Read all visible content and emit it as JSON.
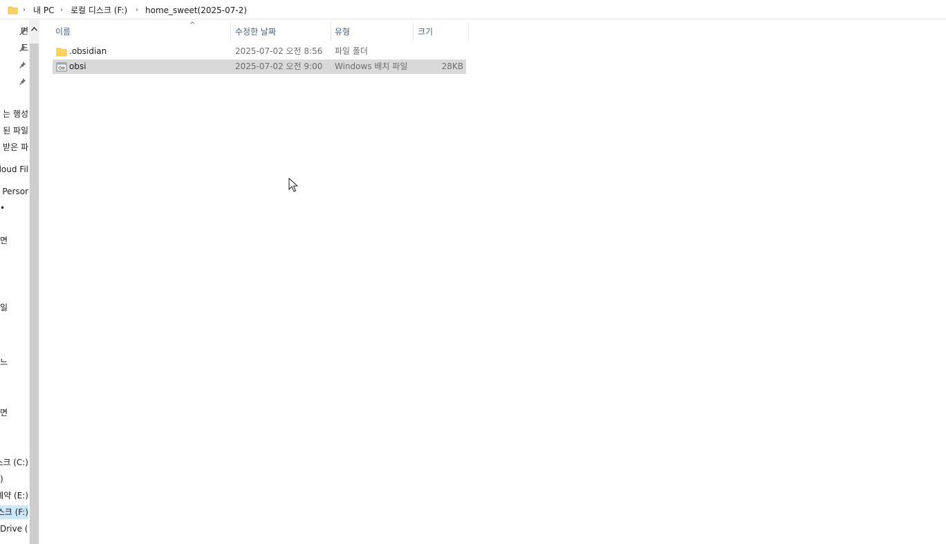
{
  "breadcrumb": {
    "items": [
      "내 PC",
      "로컬 디스크 (F:)",
      "home_sweet(2025-07-2)"
    ],
    "separator": "›"
  },
  "nav": {
    "items": [
      {
        "label": "면",
        "pinned": true
      },
      {
        "label": "드",
        "pinned": true
      },
      {
        "label": "",
        "pinned": true
      },
      {
        "label": "",
        "pinned": true
      },
      {
        "label": "는 행성"
      },
      {
        "label": "된 파일"
      },
      {
        "label": "둥 받은 파"
      },
      {
        "label": "Cloud Fil"
      },
      {
        "label": "- Persor"
      },
      {
        "label": "•"
      },
      {
        "label": "면"
      },
      {
        "label": "일"
      },
      {
        "label": "느"
      },
      {
        "label": "면"
      },
      {
        "label": "스크 (C:)"
      },
      {
        "label": ")"
      },
      {
        "label": "계약 (E:)"
      },
      {
        "label": "스크 (F:)",
        "selected": true
      },
      {
        "label": "Drive (Z"
      }
    ]
  },
  "columns": {
    "name": "이름",
    "modified": "수정한 날짜",
    "type": "유형",
    "size": "크기"
  },
  "files": [
    {
      "name": ".obsidian",
      "modified": "2025-07-02 오전 8:56",
      "type": "파일 폴더",
      "size": "",
      "icon": "folder-icon",
      "selected": false
    },
    {
      "name": "obsi",
      "modified": "2025-07-02 오전 9:00",
      "type": "Windows 배치 파일",
      "size": "28KB",
      "icon": "batch-file-icon",
      "selected": true
    }
  ],
  "colors": {
    "folder": "#ffd35c",
    "selection": "#d9d9d9",
    "nav_selected": "#cce8ff",
    "header_text": "#4c607a"
  }
}
